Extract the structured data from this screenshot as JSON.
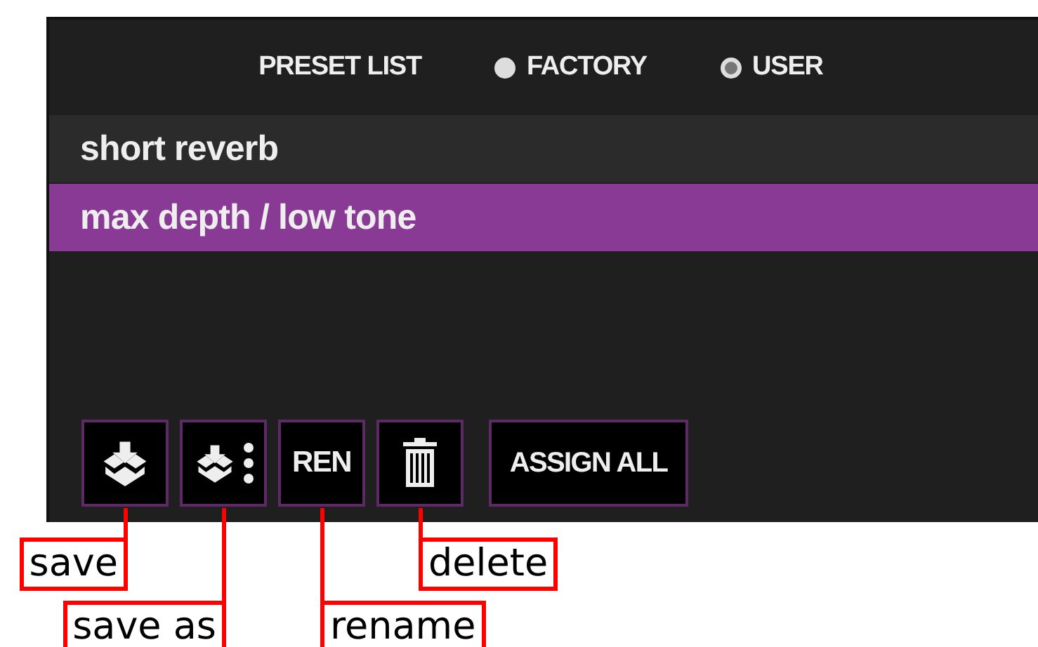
{
  "panel": {
    "title": "PRESET LIST",
    "sources": [
      {
        "label": "FACTORY",
        "selected": false
      },
      {
        "label": "USER",
        "selected": true
      }
    ],
    "presets": [
      {
        "name": "short reverb",
        "selected": false
      },
      {
        "name": "max depth / low tone",
        "selected": true
      }
    ],
    "buttons": [
      {
        "kind": "save"
      },
      {
        "kind": "save-as"
      },
      {
        "kind": "text",
        "label": "REN"
      },
      {
        "kind": "delete"
      },
      {
        "kind": "text",
        "label": "ASSIGN ALL"
      }
    ]
  },
  "annotations": [
    {
      "label": "save"
    },
    {
      "label": "save as"
    },
    {
      "label": "rename"
    },
    {
      "label": "delete"
    }
  ]
}
